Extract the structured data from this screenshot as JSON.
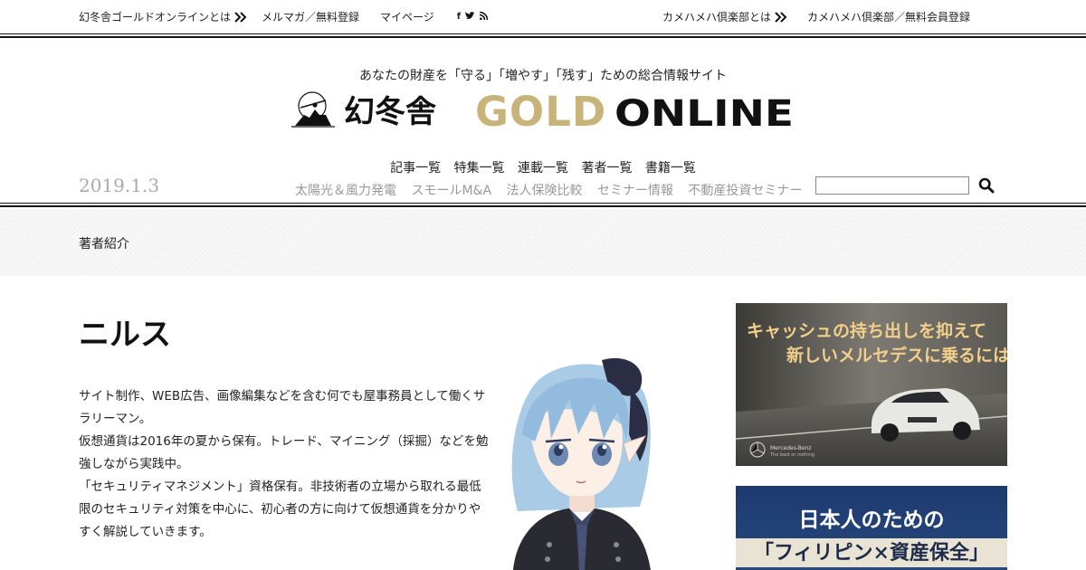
{
  "topbar": {
    "left_links": [
      "幻冬舎ゴールドオンラインとは",
      "メルマガ／無料登録",
      "マイページ"
    ],
    "social": [
      "f",
      "t",
      "rss"
    ],
    "right_links": [
      "カメハメハ倶楽部とは",
      "カメハメハ倶楽部／無料会員登録"
    ]
  },
  "header": {
    "tagline": "あなたの財産を「守る」「増やす」「残す」ための総合情報サイト",
    "logo_text": "幻冬舎 GOLD ONLINE",
    "logo_jp": "幻冬舎",
    "logo_gold": "GOLD",
    "logo_online": "ONLINE",
    "date": "2019.1.3"
  },
  "nav": {
    "main": [
      "記事一覧",
      "特集一覧",
      "連載一覧",
      "著者一覧",
      "書籍一覧"
    ],
    "sub": [
      "太陽光＆風力発電",
      "スモールM&A",
      "法人保険比較",
      "セミナー情報",
      "不動産投資セミナー"
    ],
    "search": {
      "value": "",
      "placeholder": ""
    }
  },
  "breadcrumb": {
    "current": "著者紹介"
  },
  "author": {
    "name": "ニルス",
    "bio": [
      "サイト制作、WEB広告、画像編集などを含む何でも屋事務員として働くサラリーマン。",
      "仮想通貨は2016年の夏から保有。トレード、マイニング（採掘）などを勉強しながら実践中。",
      "「セキュリティマネジメント」資格保有。非技術者の立場から取れる最低限のセキュリティ対策を中心に、初心者の方に向けて仮想通貨を分かりやすく解説していきます。"
    ]
  },
  "ads": {
    "ad1": {
      "line1": "キャッシュの持ち出しを抑えて",
      "line2": "新しいメルセデスに乗るには?",
      "brand": "Mercedes-Benz",
      "brand_sub": "The best or nothing"
    },
    "ad2": {
      "line1": "日本人のための",
      "line2": "「フィリピン×資産保全」"
    }
  },
  "colors": {
    "gold": "#c8b47a",
    "text": "#222222",
    "muted": "#999999",
    "date": "#aaaaaa",
    "ad_gold": "#f2cf8a",
    "ad_navy": "#1d3a6e"
  }
}
